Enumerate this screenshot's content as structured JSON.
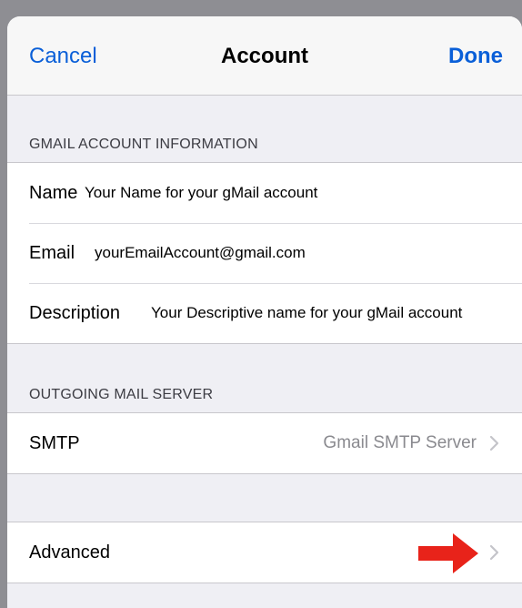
{
  "navbar": {
    "cancel_label": "Cancel",
    "title": "Account",
    "done_label": "Done"
  },
  "sections": {
    "gmail_header": "GMAIL ACCOUNT INFORMATION",
    "outgoing_header": "OUTGOING MAIL SERVER"
  },
  "account": {
    "name_label": "Name",
    "name_value": "Your Name for your gMail account",
    "email_label": "Email",
    "email_value": "yourEmailAccount@gmail.com",
    "description_label": "Description",
    "description_value": "Your Descriptive name for your gMail account"
  },
  "outgoing": {
    "smtp_label": "SMTP",
    "smtp_value": "Gmail SMTP Server"
  },
  "advanced": {
    "label": "Advanced"
  },
  "colors": {
    "accent": "#0a5fd8",
    "annotation_arrow": "#e8231a",
    "grouped_background": "#efeff4",
    "detail_text": "#8a8a8f"
  },
  "icons": {
    "disclosure": "chevron-right-icon",
    "annotation": "red-arrow-icon"
  }
}
